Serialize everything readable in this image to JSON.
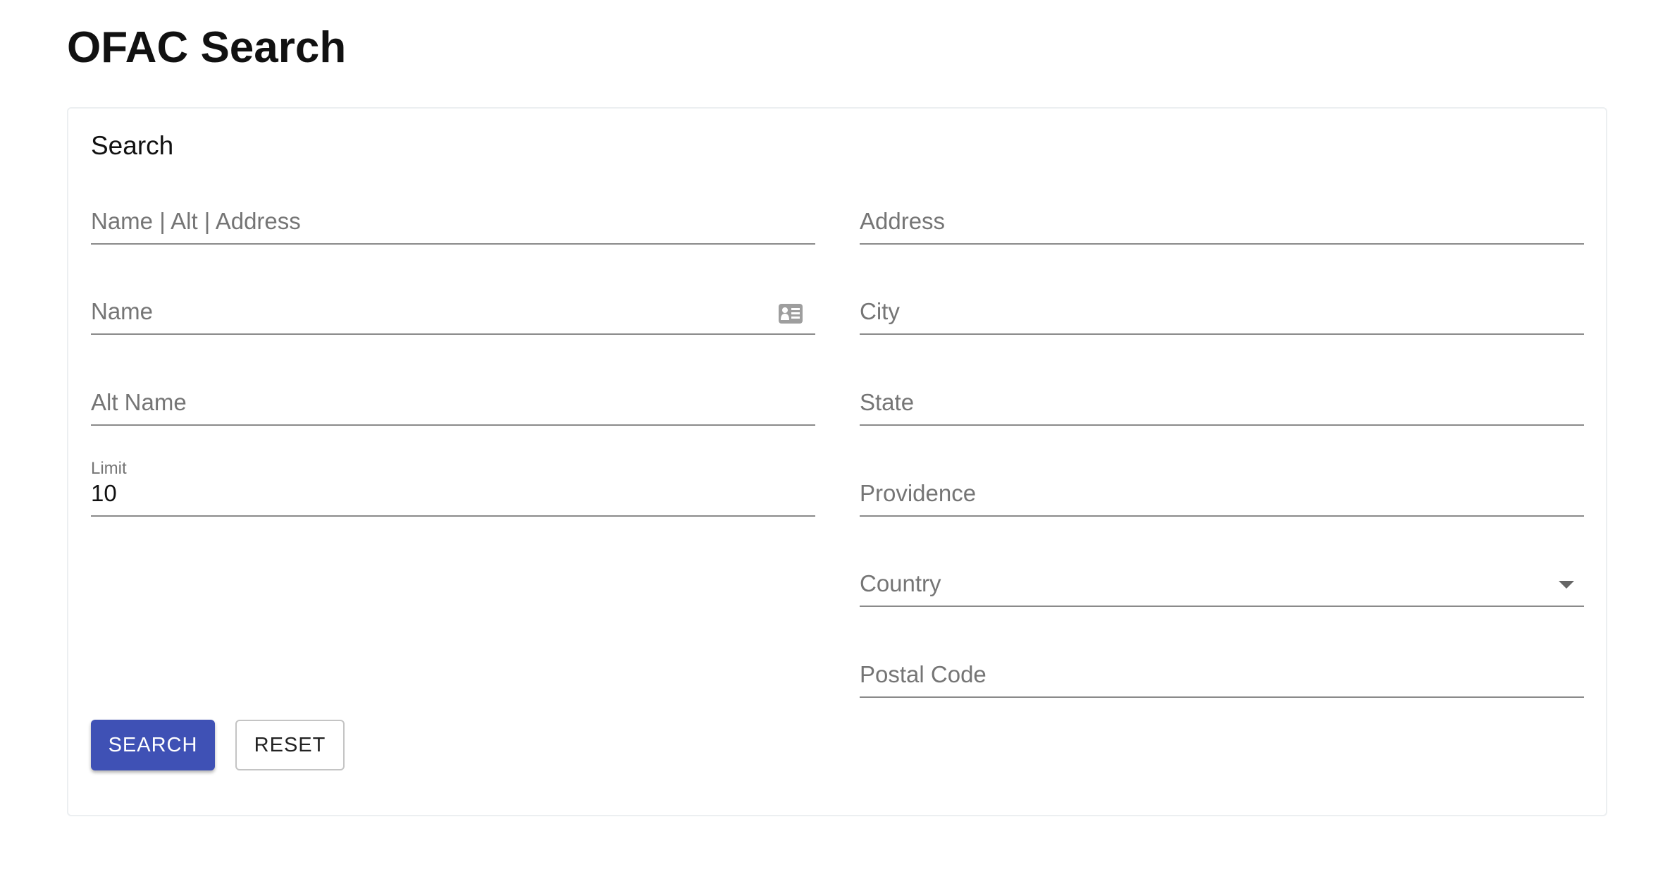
{
  "page": {
    "title": "OFAC Search"
  },
  "card": {
    "title": "Search"
  },
  "left_fields": [
    {
      "placeholder": "Name | Alt | Address"
    },
    {
      "placeholder": "Name",
      "icon": "contact-card-icon"
    },
    {
      "placeholder": "Alt Name"
    },
    {
      "label": "Limit",
      "value": "10"
    }
  ],
  "right_fields": [
    {
      "placeholder": "Address"
    },
    {
      "placeholder": "City"
    },
    {
      "placeholder": "State"
    },
    {
      "placeholder": "Providence"
    },
    {
      "placeholder": "Country",
      "icon": "dropdown-arrow-icon"
    },
    {
      "placeholder": "Postal Code"
    }
  ],
  "buttons": {
    "search": "SEARCH",
    "reset": "RESET"
  },
  "colors": {
    "primary": "#3f51b5"
  }
}
